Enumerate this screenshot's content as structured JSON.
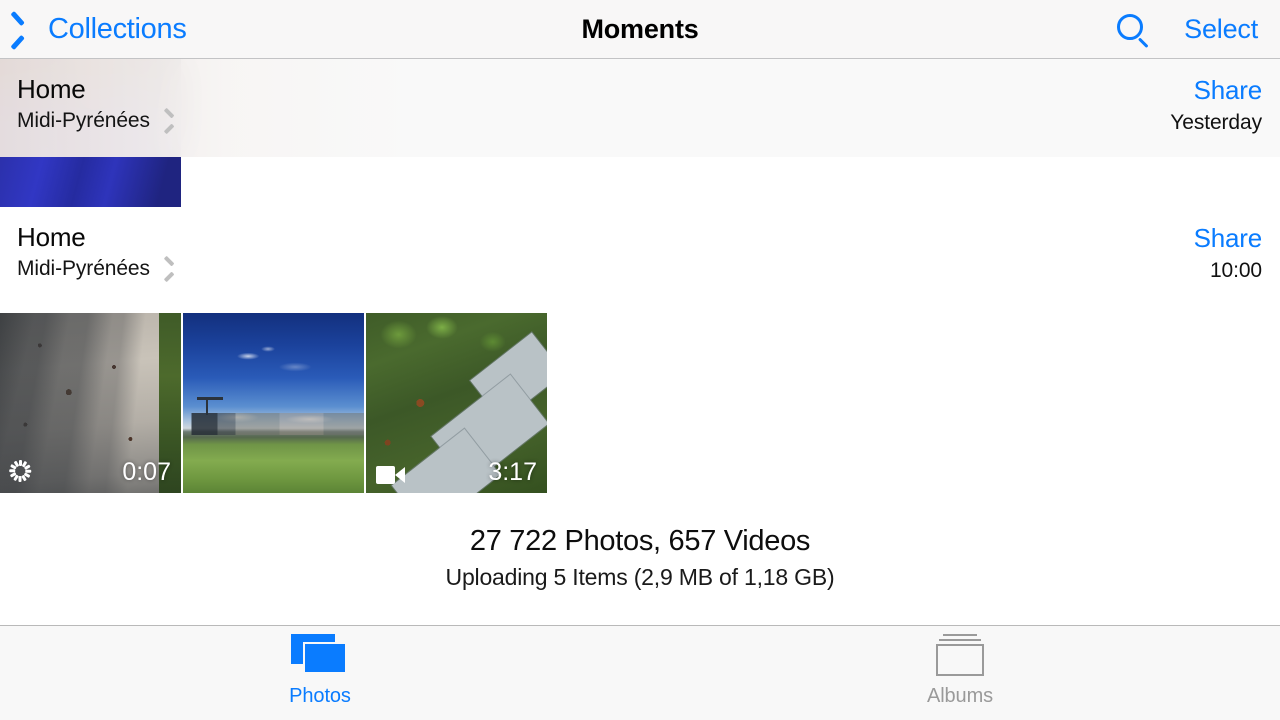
{
  "navbar": {
    "back_label": "Collections",
    "back_icon": "chevron-left-icon",
    "title": "Moments",
    "search_icon": "search-icon",
    "select_label": "Select"
  },
  "moments": [
    {
      "title": "Home",
      "subtitle": "Midi-Pyrénées",
      "disclosure_icon": "chevron-right-icon",
      "share_label": "Share",
      "time": "Yesterday",
      "thumbnails": []
    },
    {
      "title": "Home",
      "subtitle": "Midi-Pyrénées",
      "disclosure_icon": "chevron-right-icon",
      "share_label": "Share",
      "time": "10:00",
      "thumbnails": [
        {
          "badge_icon": "burst-icon",
          "duration": "0:07"
        },
        {
          "badge_icon": "",
          "duration": ""
        },
        {
          "badge_icon": "video-icon",
          "duration": "3:17"
        }
      ]
    }
  ],
  "summary": {
    "counts": "27 722 Photos, 657 Videos",
    "upload_status": "Uploading 5 Items (2,9 MB of 1,18 GB)"
  },
  "tabbar": {
    "tabs": [
      {
        "label": "Photos",
        "icon": "photos-icon",
        "active": true
      },
      {
        "label": "Albums",
        "icon": "albums-icon",
        "active": false
      }
    ]
  },
  "colors": {
    "accent_blue": "#0a7cff",
    "nav_background": "#f8f7f7",
    "tabbar_background": "#f8f8f8",
    "inactive_gray": "#9a9a9a"
  }
}
